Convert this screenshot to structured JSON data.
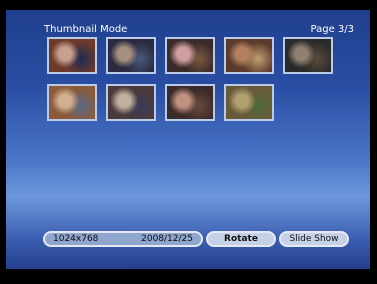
{
  "header": {
    "title": "Thumbnail Mode",
    "page": "Page 3/3"
  },
  "thumbnails": [
    {
      "name": "thumbnail-1",
      "colors": [
        "#6b3a2a",
        "#c8a090",
        "#1a2b55"
      ]
    },
    {
      "name": "thumbnail-2",
      "colors": [
        "#2a2a40",
        "#a89080",
        "#4a5a7a"
      ]
    },
    {
      "name": "thumbnail-3",
      "colors": [
        "#3a2a2a",
        "#d0a0a0",
        "#7a5a40"
      ]
    },
    {
      "name": "thumbnail-4",
      "colors": [
        "#5a3a2a",
        "#b08060",
        "#c0a070"
      ]
    },
    {
      "name": "thumbnail-5",
      "colors": [
        "#2a2a2a",
        "#908070",
        "#5a4a3a"
      ]
    },
    {
      "name": "thumbnail-6",
      "colors": [
        "#8a5a3a",
        "#d0b090",
        "#5a6a8a"
      ]
    },
    {
      "name": "thumbnail-7",
      "colors": [
        "#4a3a3a",
        "#c0b0a0",
        "#3a3a5a"
      ]
    },
    {
      "name": "thumbnail-8",
      "colors": [
        "#3a2a2a",
        "#c09080",
        "#6a4a3a"
      ]
    },
    {
      "name": "thumbnail-9",
      "colors": [
        "#6a5a3a",
        "#b0a070",
        "#4a6a3a"
      ]
    }
  ],
  "footer": {
    "resolution": "1024x768",
    "date": "2008/12/25",
    "rotate_label": "Rotate",
    "slideshow_label": "Slide Show"
  }
}
